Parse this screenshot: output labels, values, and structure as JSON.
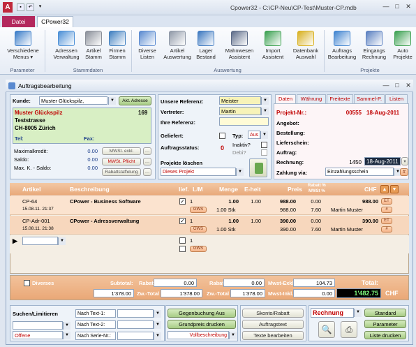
{
  "app": {
    "title": "Cpower32 - C:\\CP-Neu\\CP-Test\\Muster-CP.mdb",
    "tab_file": "Datei",
    "tab_main": "CPower32"
  },
  "ribbon": {
    "buttons": [
      {
        "id": "menus",
        "label": "Verschiedene\nMenus ▾",
        "icon": "menu-icon",
        "color": "#3a7cc8"
      },
      {
        "id": "adressen",
        "label": "Adressen\nVerwaltung",
        "icon": "address-book-icon",
        "color": "#4b8fd6"
      },
      {
        "id": "artikel",
        "label": "Artikel\nStamm",
        "icon": "tools-icon",
        "color": "#8a8f99"
      },
      {
        "id": "firmen",
        "label": "Firmen\nStamm",
        "icon": "firm-icon",
        "color": "#3f7fc0"
      },
      {
        "id": "diverse",
        "label": "Diverse\nListen",
        "icon": "list-icon",
        "color": "#5a8ad0"
      },
      {
        "id": "artausw",
        "label": "Artikel\nAuswertung",
        "icon": "chart-tools-icon",
        "color": "#9099a8"
      },
      {
        "id": "lager",
        "label": "Lager\nBestand",
        "icon": "warehouse-icon",
        "color": "#3c78c0"
      },
      {
        "id": "mahn",
        "label": "Mahnwesen\nAssistent",
        "icon": "reminder-icon",
        "color": "#5c6b88"
      },
      {
        "id": "import",
        "label": "Import\nAssistent",
        "icon": "import-icon",
        "color": "#3aa050"
      },
      {
        "id": "db",
        "label": "Datenbank\nAuswahl",
        "icon": "database-shield-icon",
        "color": "#d8b020"
      },
      {
        "id": "auftrag",
        "label": "Auftrags\nBearbeitung",
        "icon": "order-icon",
        "color": "#3f83d0"
      },
      {
        "id": "eingang",
        "label": "Eingangs\nRechnung",
        "icon": "invoice-icon",
        "color": "#5a7fc0"
      },
      {
        "id": "auto",
        "label": "Auto\nProjekte",
        "icon": "auto-project-icon",
        "color": "#3aa050"
      }
    ],
    "groups": [
      "Parameter",
      "Stammdaten",
      "Auswertung",
      "Projekte"
    ]
  },
  "window": {
    "title": "Auftragsbearbeitung"
  },
  "customer": {
    "kunde_label": "Kunde:",
    "kunde_value": "Muster Glückspilz,",
    "akt_adresse": "Akt. Adresse",
    "name": "Muster Glückspilz",
    "number": "169",
    "street": "Teststrasse",
    "city": "CH-8005 Zürich",
    "tel_label": "Tel:",
    "fax_label": "Fax:",
    "maxkredit_label": "Maximalkredit:",
    "maxkredit": "0.00",
    "saldo_label": "Saldo:",
    "saldo": "0.00",
    "maxk_saldo_label": "Max. K. - Saldo:",
    "maxk_saldo": "0.00",
    "mwst_exkl": "MWSt. exkl.",
    "mwst_pflicht": "MWSt. Pflicht",
    "rabattstaffelung": "Rabattstaffelung"
  },
  "reference": {
    "unsere_label": "Unsere Referenz:",
    "unsere_value": "Meister",
    "vertreter_label": "Vertreter:",
    "vertreter_value": "Martin",
    "ihre_label": "Ihre Referenz:",
    "ihre_value": "",
    "geliefert_label": "Geliefert:",
    "typ_label": "Typ:",
    "typ_value": "Aus",
    "status_label": "Auftragsstatus:",
    "status_value": "0",
    "inaktiv_label": "Inaktiv?",
    "debi_label": "Debi?",
    "projekte_label": "Projekte löschen",
    "projekte_value": "Dieses Projekt"
  },
  "datepanel": {
    "tabs": [
      "Daten",
      "Währung",
      "Freitexte",
      "Sammel-P.",
      "Listen"
    ],
    "projekt_label": "Projekt-Nr.:",
    "projekt_nr": "00555",
    "projekt_date": "18-Aug-2011",
    "angebot_label": "Angebot:",
    "bestellung_label": "Bestellung:",
    "lieferschein_label": "Lieferschein:",
    "auftrag_label": "Auftrag:",
    "rechnung_label": "Rechnung:",
    "rechnung_nr": "1450",
    "rechnung_date": "18-Aug-2011",
    "zahlung_label": "Zahlung via:",
    "zahlung_value": "Einzahlungsschein"
  },
  "grid": {
    "headers": {
      "artikel": "Artikel",
      "beschreibung": "Beschreibung",
      "lief": "lief.",
      "lm": "L/M",
      "menge": "Menge",
      "eheit": "E-heit",
      "preis": "Preis",
      "rabatt": "Rabatt %",
      "mwst": "MWSt %",
      "chf": "CHF"
    },
    "rows": [
      {
        "art": "CP-64",
        "date": "15.08.11. 21:37",
        "desc": "CPower - Business Software",
        "lief": "1",
        "menge": "1.00",
        "eheit": "1.00",
        "preis": "988.00",
        "rabatt": "0.00",
        "chf": "988.00",
        "stk": "1.00 Stk",
        "preis2": "988.00",
        "mwst": "7.60",
        "person": "Martin Muster",
        "gws": "GWS"
      },
      {
        "art": "CP-Adr-001",
        "date": "15.08.11. 21:38",
        "desc": "CPower - Adressverwaltung",
        "lief": "1",
        "menge": "1.00",
        "eheit": "1.00",
        "preis": "390.00",
        "rabatt": "0.00",
        "chf": "390.00",
        "stk": "1.00 Stk",
        "preis2": "390.00",
        "mwst": "7.60",
        "person": "Martin Muster",
        "gws": "GWS"
      }
    ],
    "new_lief": "1",
    "new_gws": "GWS"
  },
  "totals": {
    "diverses": "Diverses",
    "subtotal_label": "Subtotal:",
    "rabatt1_label": "Rabatt I",
    "rabatt1": "0.00",
    "rabatt2_label": "Rabatt II",
    "rabatt2": "0.00",
    "mwst_exkl_label": "Mwst-Exkl.",
    "mwst_exkl": "104.73",
    "total_label": "Total:",
    "subtotal": "1'378.00",
    "zwtotal1_label": "Zw.-Total",
    "zwtotal1": "1'378.00",
    "zwtotal2_label": "Zw.-Total",
    "zwtotal2": "1'378.00",
    "mwst_inkl_label": "Mwst-Inkl.",
    "mwst_inkl": "0.00",
    "total": "1'482.75",
    "currency": "CHF"
  },
  "footer": {
    "suchen": "Suchen/Limitieren",
    "offene": "Offene",
    "nach1": "Nach Text-1:",
    "nach2": "Nach Text-2:",
    "nach3": "Nach Serie-Nr.:",
    "gegenbuchung": "Gegenbuchung Aus",
    "grundpreis": "Grundpreis drucken",
    "vollbeschreibung": "Vollbeschreibung",
    "skonto": "Skonto/Rabatt",
    "auftragstext": "Auftragstext",
    "texte": "Texte bearbeiten",
    "rechnung": "Rechnung",
    "standard": "Standard",
    "parameter": "Parameter",
    "liste": "Liste drucken"
  }
}
